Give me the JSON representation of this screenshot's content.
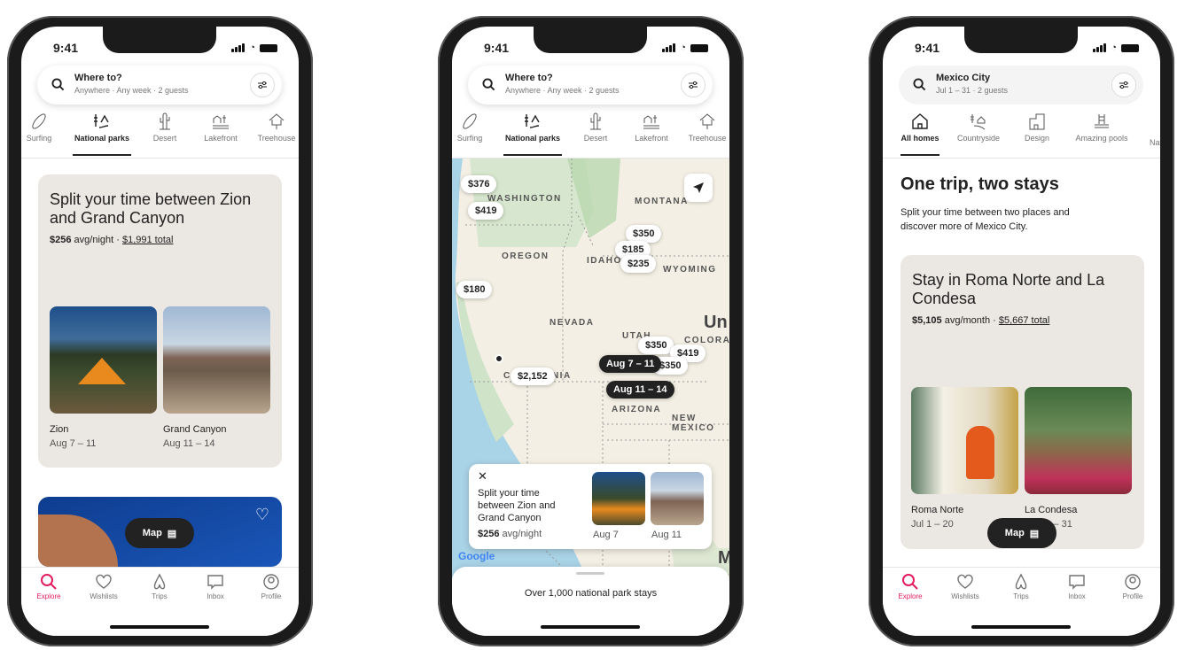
{
  "status_time": "9:41",
  "colors": {
    "accent": "#e31c5f",
    "card_bg": "#ebe7e2",
    "dark": "#222222"
  },
  "tabs": [
    {
      "label": "Explore",
      "icon": "search-icon",
      "active": true
    },
    {
      "label": "Wishlists",
      "icon": "heart-icon"
    },
    {
      "label": "Trips",
      "icon": "airbnb-logo-icon"
    },
    {
      "label": "Inbox",
      "icon": "message-icon"
    },
    {
      "label": "Profile",
      "icon": "profile-icon"
    }
  ],
  "map_button": {
    "label": "Map",
    "icon": "map-icon"
  },
  "phone1": {
    "search": {
      "title": "Where to?",
      "subtitle": "Anywhere · Any week · 2 guests"
    },
    "categories": [
      {
        "label": "Surfing",
        "icon": "surfboard-icon"
      },
      {
        "label": "National parks",
        "icon": "national-park-icon",
        "active": true
      },
      {
        "label": "Desert",
        "icon": "cactus-icon"
      },
      {
        "label": "Lakefront",
        "icon": "lakefront-icon"
      },
      {
        "label": "Treehouse",
        "icon": "treehouse-icon"
      }
    ],
    "card": {
      "title": "Split your time between Zion and Grand Canyon",
      "price_bold": "$256",
      "price_suffix": " avg/night · ",
      "total": "$1,991 total",
      "stays": [
        {
          "name": "Zion",
          "dates": "Aug 7 – 11"
        },
        {
          "name": "Grand Canyon",
          "dates": "Aug 11 – 14"
        }
      ]
    }
  },
  "phone2": {
    "search": {
      "title": "Where to?",
      "subtitle": "Anywhere · Any week · 2 guests"
    },
    "map_labels": [
      "WASHINGTON",
      "MONTANA",
      "OREGON",
      "IDAHO",
      "WYOMING",
      "NEVADA",
      "UTAH",
      "COLORADO",
      "CALIFORNIA",
      "ARIZONA",
      "NEW MEXICO",
      "Un",
      "M"
    ],
    "pins": [
      "$376",
      "$419",
      "$350",
      "$185",
      "$235",
      "$180",
      "$350",
      "$419",
      "$350",
      "$2,152"
    ],
    "date_pins": [
      "Aug 7 – 11",
      "Aug 11 – 14"
    ],
    "info_card": {
      "title": "Split your time between Zion and Grand Canyon",
      "price_bold": "$256",
      "price_suffix": " avg/night",
      "dates": [
        "Aug 7",
        "Aug 11"
      ]
    },
    "google": "Google",
    "sheet_text": "Over 1,000 national park stays"
  },
  "phone3": {
    "search": {
      "title": "Mexico City",
      "subtitle": "Jul 1 – 31 · 2 guests"
    },
    "categories": [
      {
        "label": "All homes",
        "icon": "house-icon",
        "active": true
      },
      {
        "label": "Countryside",
        "icon": "countryside-icon"
      },
      {
        "label": "Design",
        "icon": "design-icon"
      },
      {
        "label": "Amazing pools",
        "icon": "pool-icon"
      },
      {
        "label": "Nati",
        "icon": ""
      }
    ],
    "heading": "One trip, two stays",
    "subheading": "Split your time between two places and discover more of Mexico City.",
    "card": {
      "title": "Stay in Roma Norte and La Condesa",
      "price_bold": "$5,105",
      "price_suffix": " avg/month · ",
      "total": "$5,667 total",
      "stays": [
        {
          "name": "Roma Norte",
          "dates": "Jul 1 – 20"
        },
        {
          "name": "La Condesa",
          "dates": "Jul 20 – 31"
        }
      ]
    }
  }
}
